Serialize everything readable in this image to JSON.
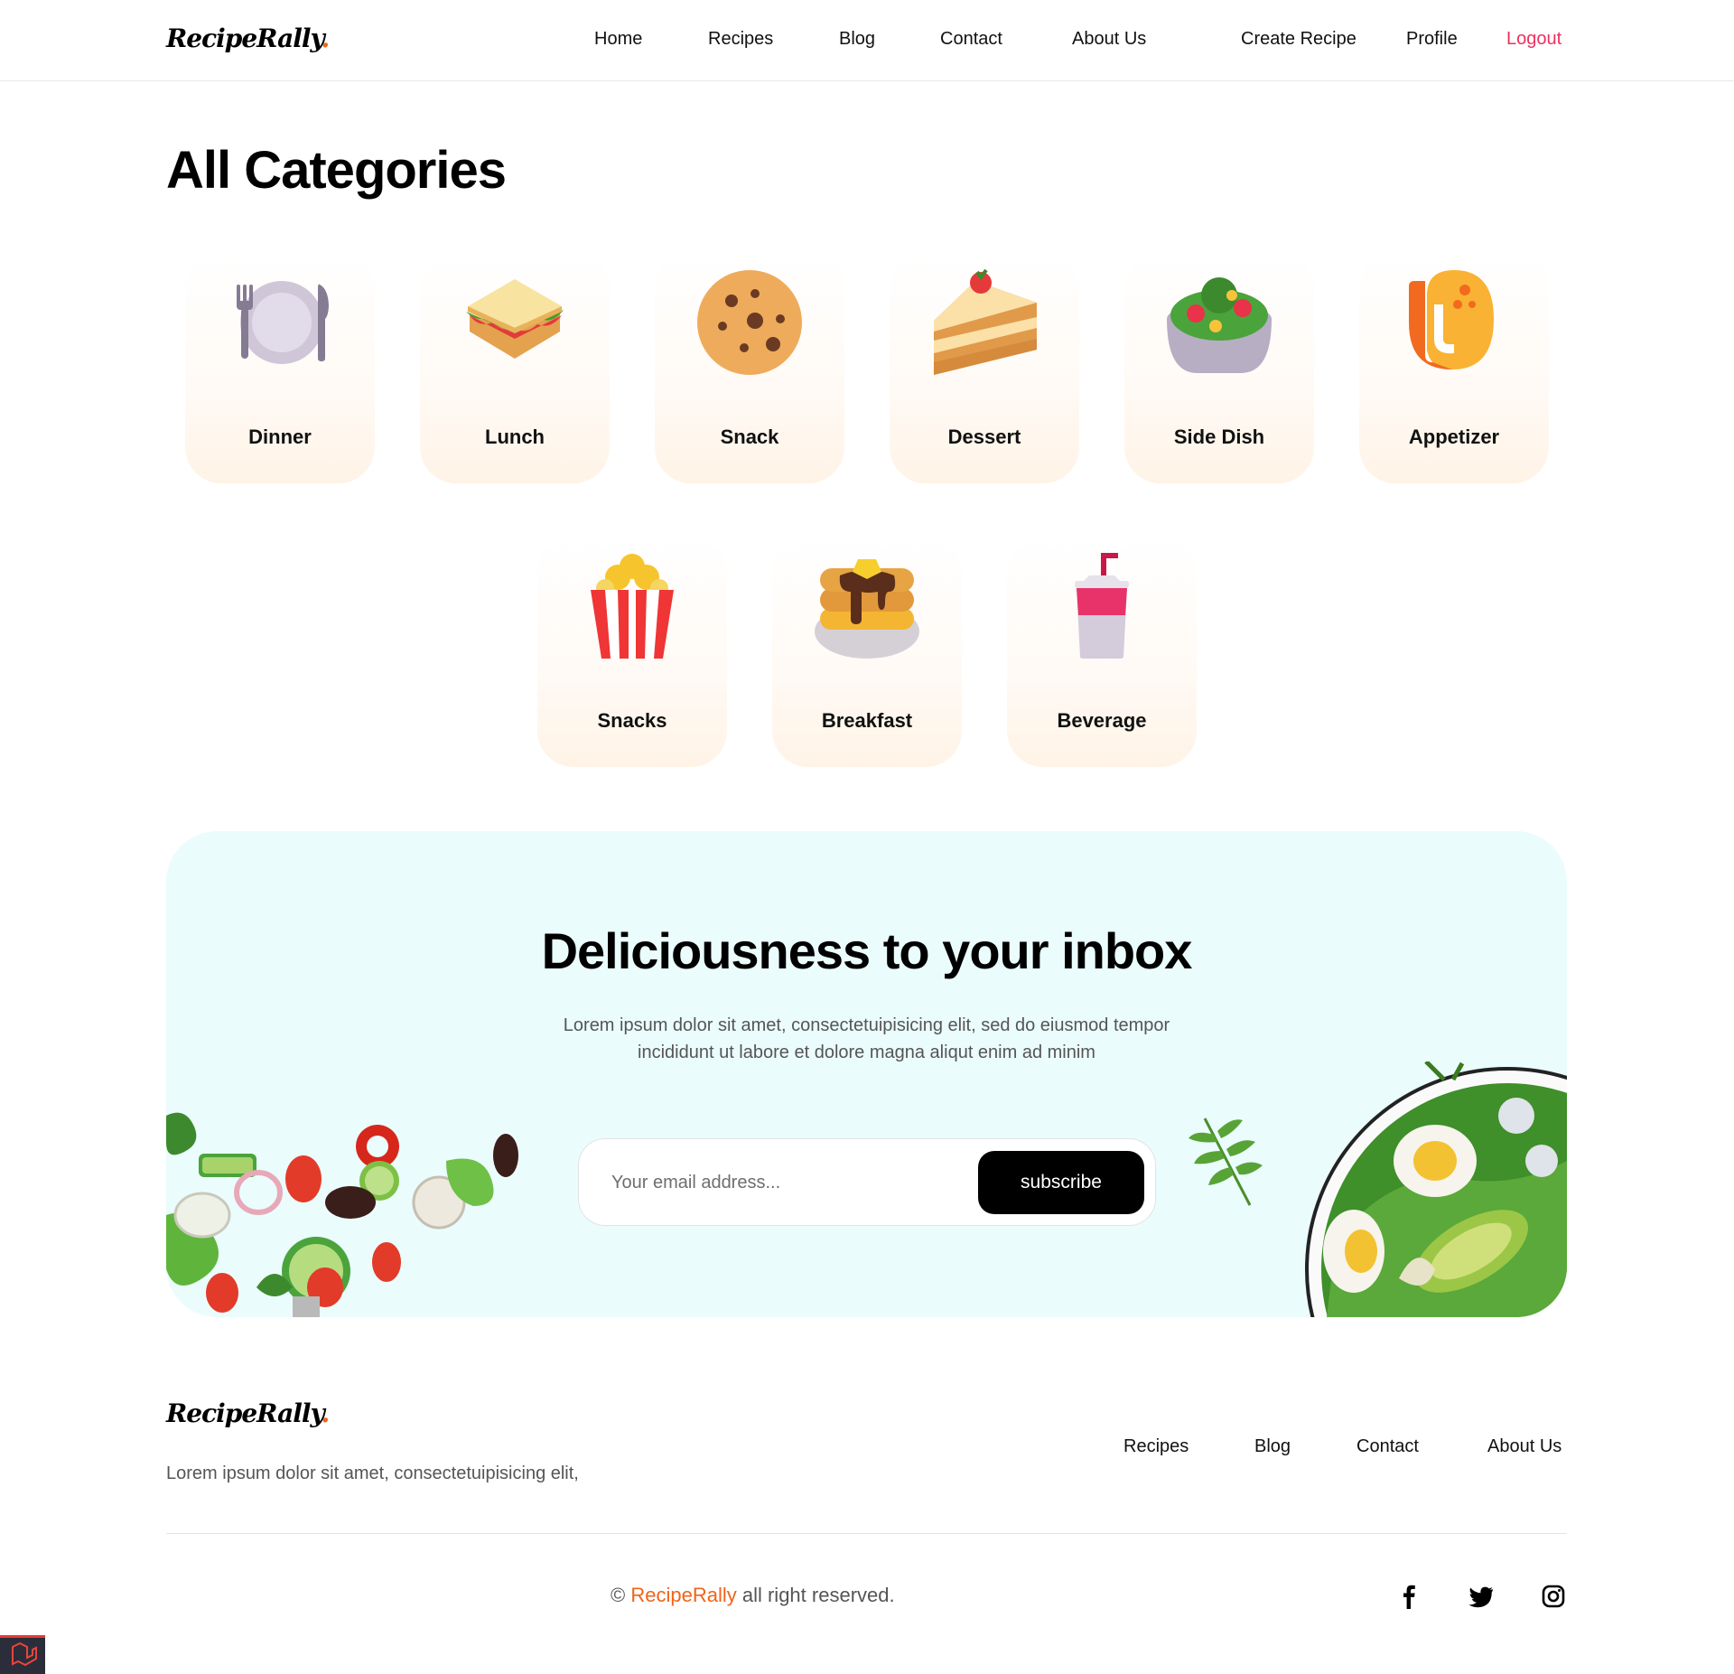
{
  "header": {
    "logo_text": "RecipeRally",
    "logo_dot": ".",
    "nav": [
      "Home",
      "Recipes",
      "Blog",
      "Contact",
      "About Us"
    ],
    "create_recipe": "Create Recipe",
    "profile": "Profile",
    "logout": "Logout"
  },
  "main": {
    "title": "All Categories",
    "categories": [
      {
        "label": "Dinner",
        "icon": "plate-cutlery-icon"
      },
      {
        "label": "Lunch",
        "icon": "sandwich-icon"
      },
      {
        "label": "Snack",
        "icon": "cookie-icon"
      },
      {
        "label": "Dessert",
        "icon": "cake-slice-icon"
      },
      {
        "label": "Side Dish",
        "icon": "salad-bowl-icon"
      },
      {
        "label": "Appetizer",
        "icon": "shrimp-icon"
      },
      {
        "label": "Snacks",
        "icon": "popcorn-icon"
      },
      {
        "label": "Breakfast",
        "icon": "pancakes-icon"
      },
      {
        "label": "Beverage",
        "icon": "drink-cup-icon"
      }
    ]
  },
  "newsletter": {
    "title": "Deliciousness to your inbox",
    "description": "Lorem ipsum dolor sit amet, consectetuipisicing elit, sed do eiusmod tempor incididunt ut labore et dolore magna aliqut enim ad minim",
    "email_placeholder": "Your email address...",
    "button_label": "subscribe"
  },
  "footer": {
    "logo_text": "RecipeRally",
    "logo_dot": ".",
    "description": "Lorem ipsum dolor sit amet, consectetuipisicing elit,",
    "links": [
      "Recipes",
      "Blog",
      "Contact",
      "About Us"
    ],
    "copyright_symbol": "©",
    "copyright_brand": "RecipeRally",
    "copyright_rest": "all right reserved.",
    "social": [
      "facebook-icon",
      "twitter-icon",
      "instagram-icon"
    ]
  },
  "colors": {
    "accent_orange": "#f06418",
    "logout_pink": "#ee2f60",
    "newsletter_bg": "#ebfcfd",
    "card_tint": "#fff3e6"
  }
}
